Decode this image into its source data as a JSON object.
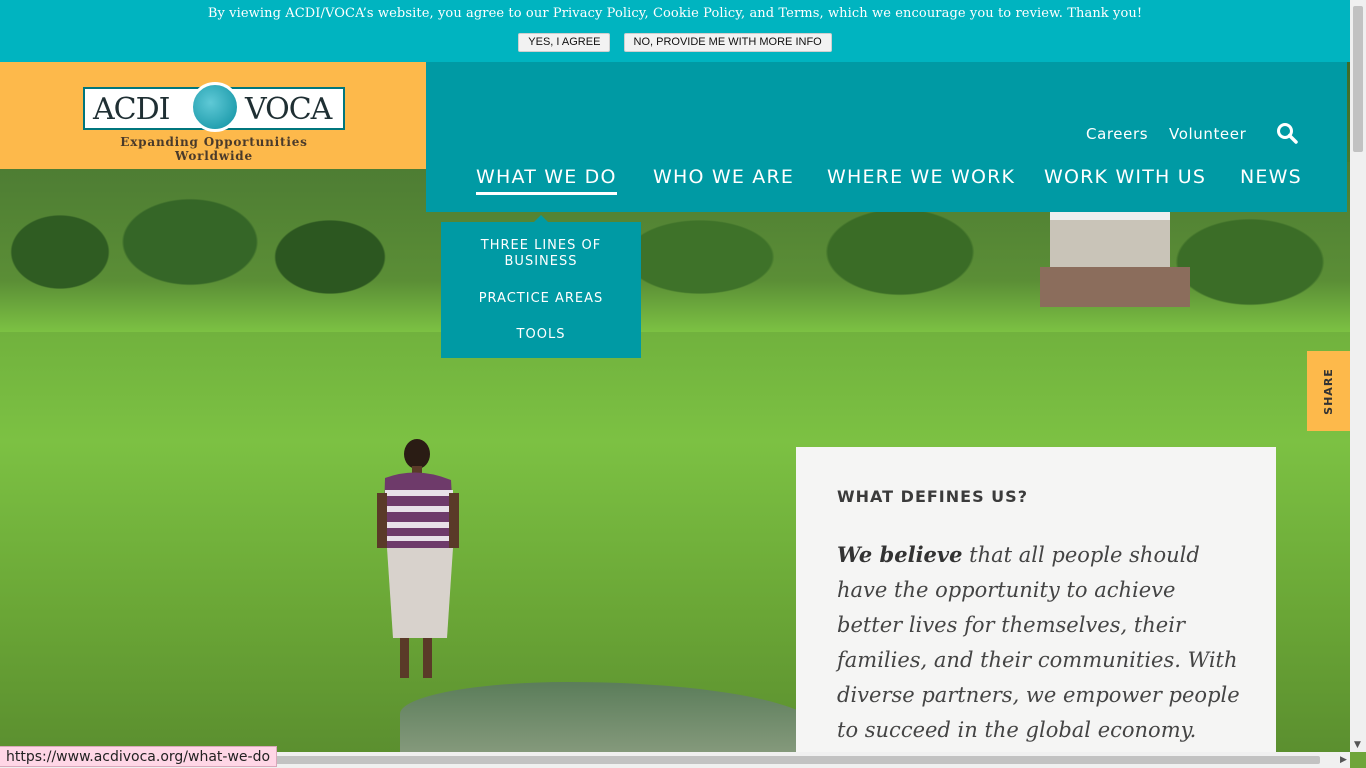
{
  "cookie_bar": {
    "message": "By viewing ACDI/VOCA’s website, you agree to our Privacy Policy, Cookie Policy, and Terms, which we encourage you to review. Thank you!",
    "agree_label": "YES, I AGREE",
    "more_info_label": "NO, PROVIDE ME WITH MORE INFO"
  },
  "logo": {
    "left_word": "ACDI",
    "right_word": "VOCA",
    "tagline": "Expanding Opportunities Worldwide"
  },
  "utility_nav": {
    "careers": "Careers",
    "volunteer": "Volunteer",
    "search_icon": "search-icon"
  },
  "main_nav": {
    "items": [
      {
        "label": "WHAT WE DO",
        "active": true
      },
      {
        "label": "WHO WE ARE",
        "active": false
      },
      {
        "label": "WHERE WE WORK",
        "active": false
      },
      {
        "label": "WORK WITH US",
        "active": false
      },
      {
        "label": "NEWS",
        "active": false
      }
    ]
  },
  "dropdown": {
    "items": [
      "THREE LINES OF BUSINESS",
      "PRACTICE AREAS",
      "TOOLS"
    ]
  },
  "share": {
    "label": "SHARE"
  },
  "card": {
    "heading": "WHAT DEFINES US?",
    "lead": "We believe",
    "body": " that all people should have the opportunity to achieve better lives for themselves, their families, and their communities. With diverse partners, we empower people to succeed in the global economy."
  },
  "status_bar": {
    "url": "https://www.acdivoca.org/what-we-do"
  },
  "colors": {
    "cookie_bar": "#00b4c0",
    "nav_teal": "#009aa4",
    "logo_orange": "#fdb94b",
    "card_bg": "#f5f5f4"
  }
}
